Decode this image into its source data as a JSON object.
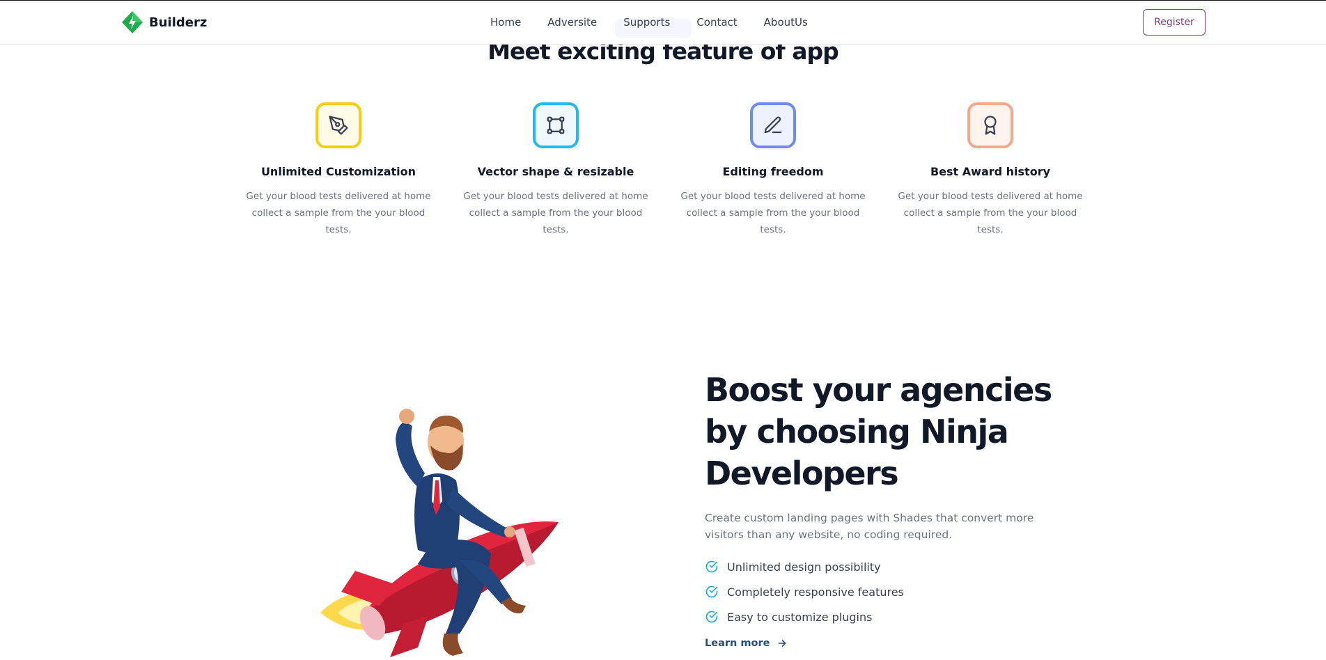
{
  "brand": {
    "name": "Builderz",
    "icon": "diamond-logo-icon",
    "color": "#1faa4b"
  },
  "nav": {
    "items": [
      {
        "label": "Home"
      },
      {
        "label": "Adversite"
      },
      {
        "label": "Supports"
      },
      {
        "label": "Contact"
      },
      {
        "label": "AboutUs"
      }
    ],
    "register_label": "Register",
    "accent": "#7e3a7f"
  },
  "features": {
    "title": "Meet exciting feature of app",
    "items": [
      {
        "title": "Unlimited Customization",
        "text": "Get your blood tests delivered at home collect a sample from the your blood tests.",
        "icon": "pen-tool-icon",
        "color": "#facc15"
      },
      {
        "title": "Vector shape & resizable",
        "text": "Get your blood tests delivered at home collect a sample from the your blood tests.",
        "icon": "vector-square-icon",
        "color": "#22b8f0"
      },
      {
        "title": "Editing freedom",
        "text": "Get your blood tests delivered at home collect a sample from the your blood tests.",
        "icon": "edit-pencil-icon",
        "color": "#6b8cf0"
      },
      {
        "title": "Best Award history",
        "text": "Get your blood tests delivered at home collect a sample from the your blood tests.",
        "icon": "award-ribbon-icon",
        "color": "#f5a98a"
      }
    ]
  },
  "boost": {
    "title": "Boost your agencies by choosing Ninja Developers",
    "description": "Create custom landing pages with Shades that convert more visitors than any website, no coding required.",
    "checklist": [
      "Unlimited design possibility",
      "Completely responsive features",
      "Easy to customize plugins"
    ],
    "check_color": "#1ea7e0",
    "learn_more": "Learn more"
  }
}
